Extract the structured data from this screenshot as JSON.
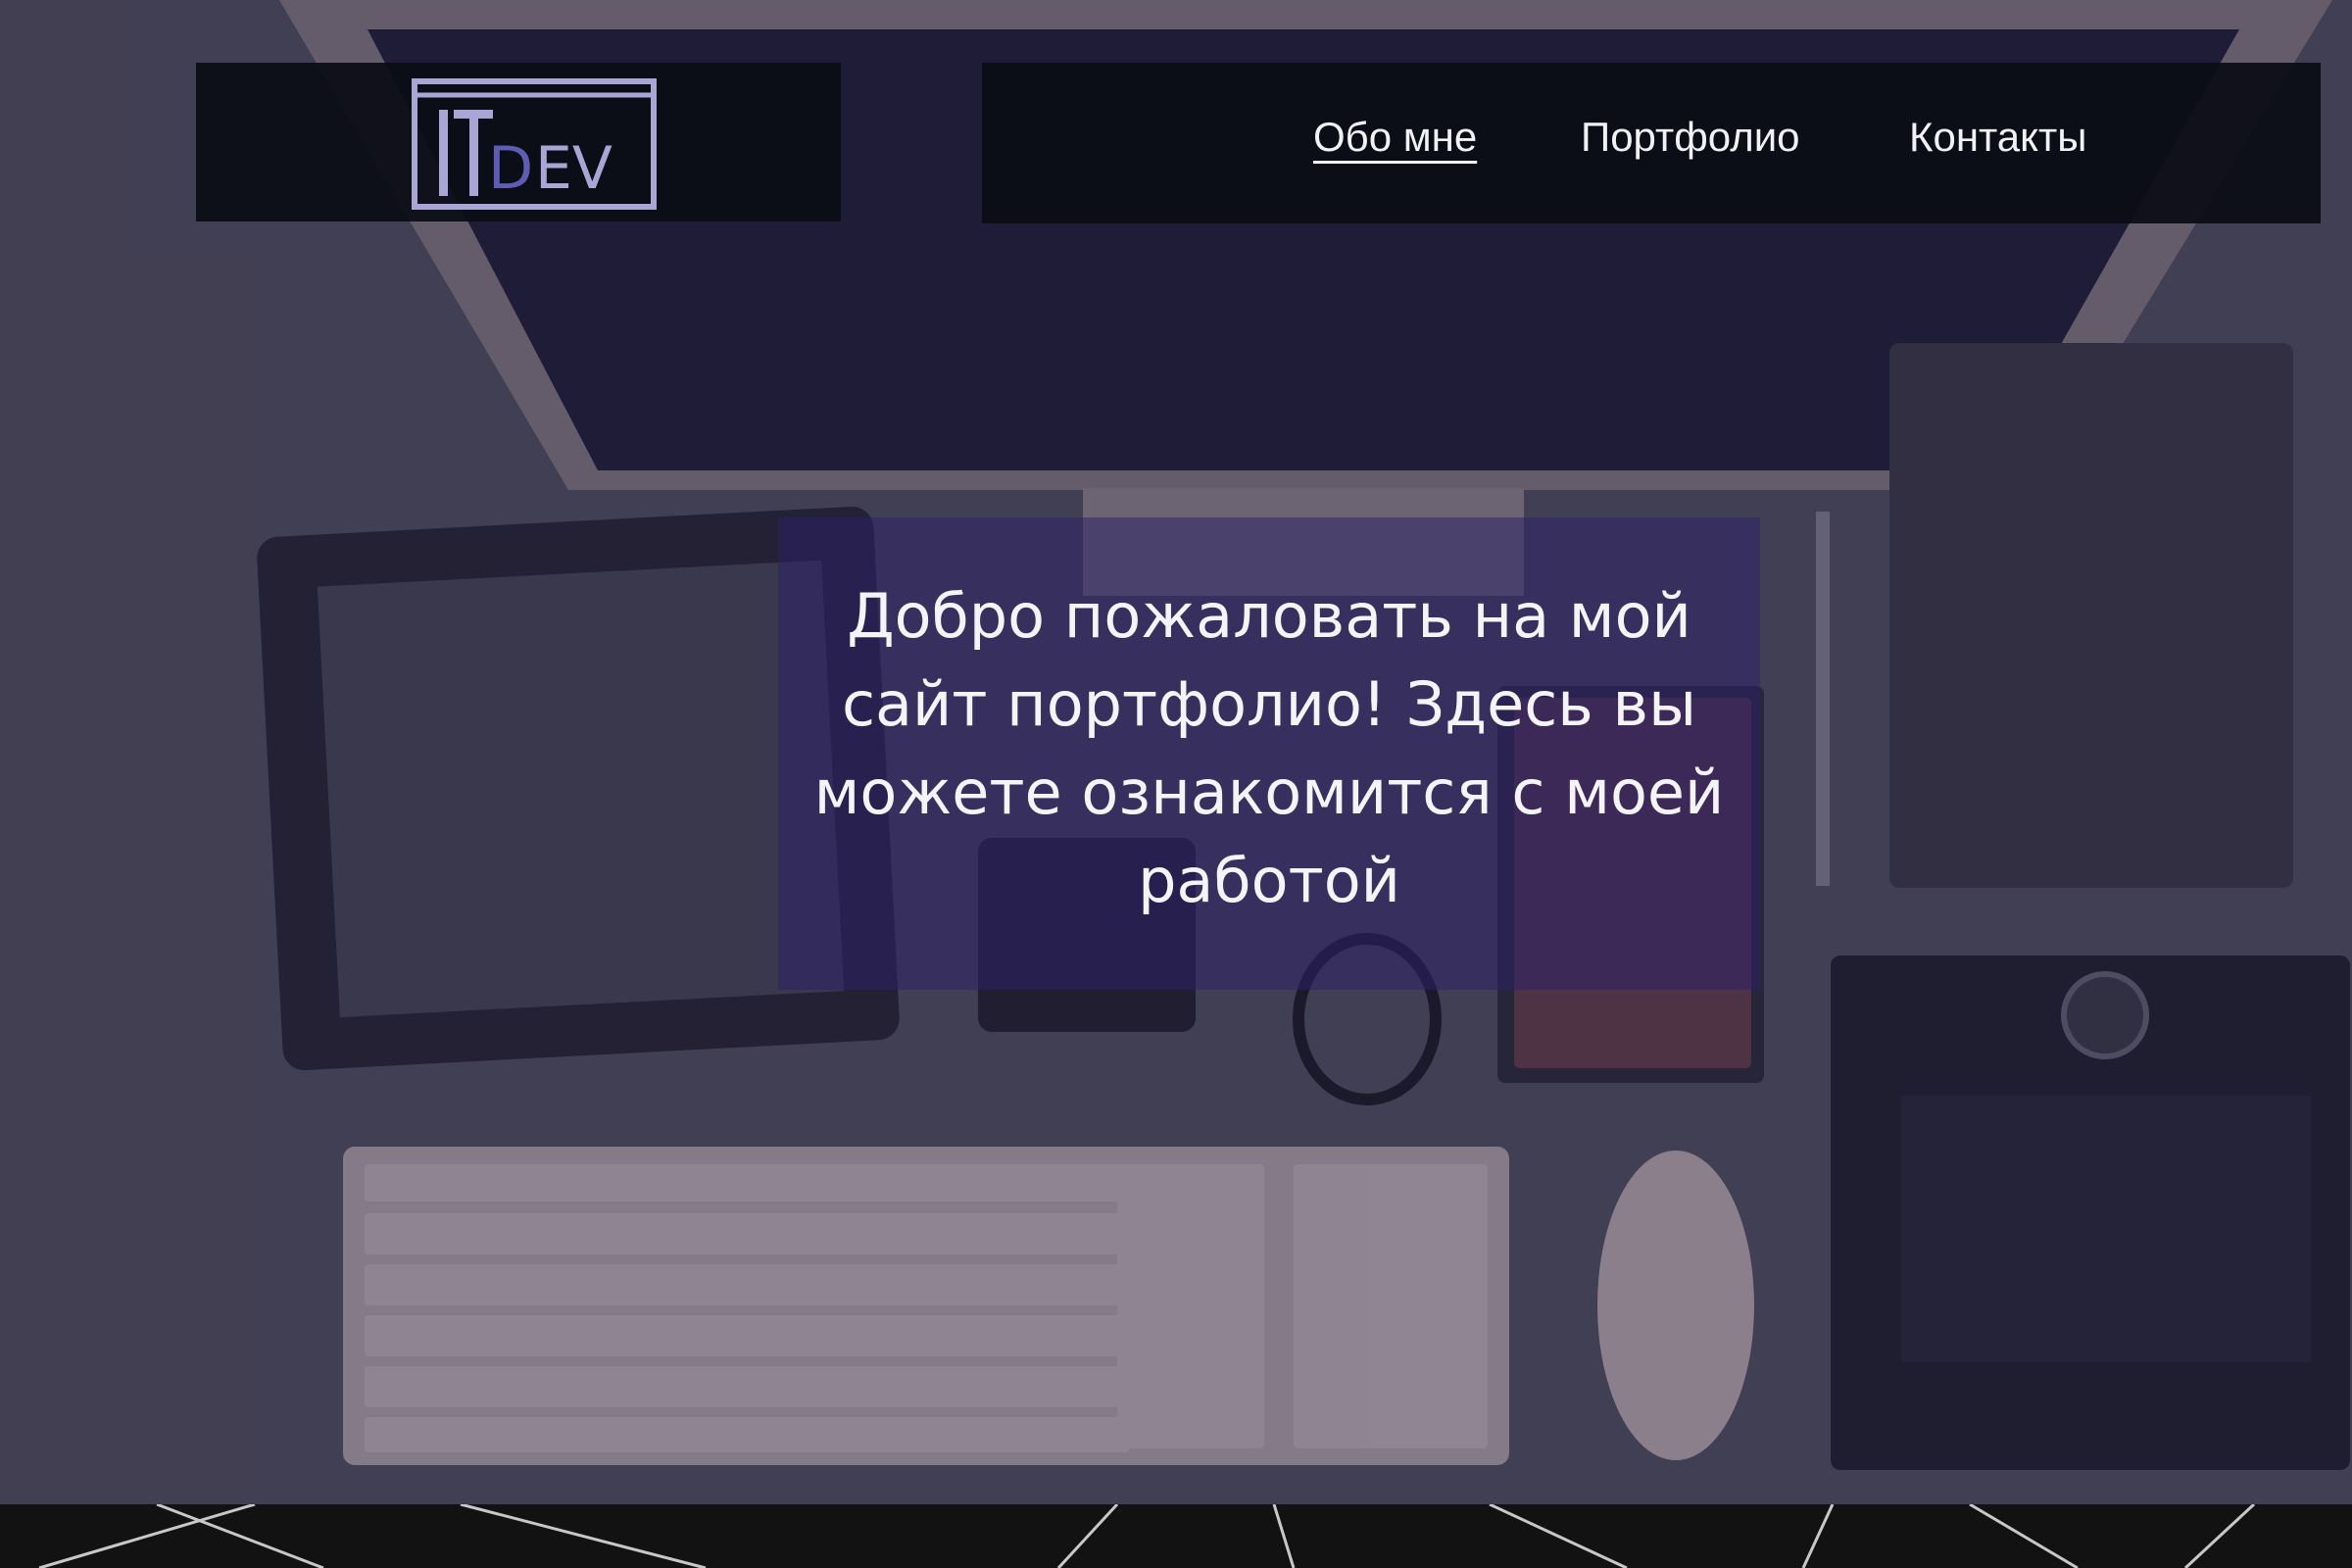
{
  "header": {
    "logo_text": "ITDEV",
    "nav": [
      {
        "label": "Обо мне",
        "active": true
      },
      {
        "label": "Портфолио",
        "active": false
      },
      {
        "label": "Контакты",
        "active": false
      }
    ]
  },
  "hero": {
    "welcome_text": "Добро пожаловать на мой сайт портфолио! Здесь вы можете ознакомится с моей работой",
    "overlay_color": "#2e206a"
  },
  "colors": {
    "nav_background": "#0a0c14",
    "logo_color": "#a9a6d6",
    "text": "#f2f2f4"
  }
}
